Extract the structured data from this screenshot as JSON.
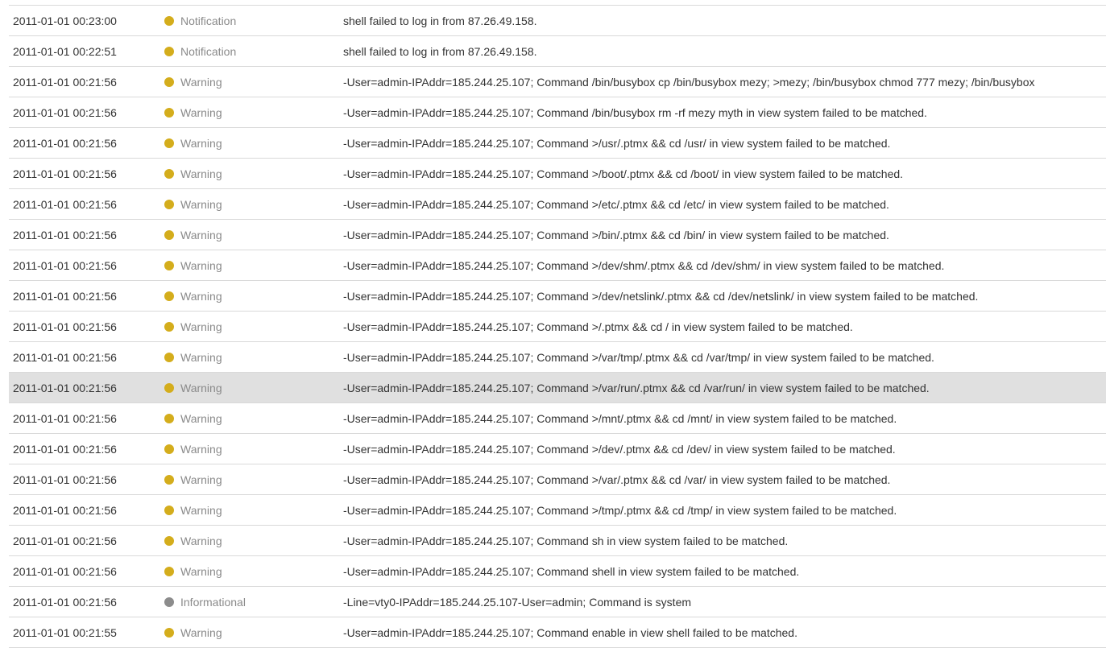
{
  "colors": {
    "warning": "#d4ad1c",
    "notification": "#d4ad1c",
    "informational": "#8c8c8c",
    "selected_row": "#e0e0e0"
  },
  "selected_index": 12,
  "rows": [
    {
      "time": "2011-01-01 00:23:00",
      "level": "Notification",
      "dot": "notification",
      "message": "shell failed to log in from 87.26.49.158."
    },
    {
      "time": "2011-01-01 00:22:51",
      "level": "Notification",
      "dot": "notification",
      "message": "shell failed to log in from 87.26.49.158."
    },
    {
      "time": "2011-01-01 00:21:56",
      "level": "Warning",
      "dot": "warning",
      "message": "-User=admin-IPAddr=185.244.25.107; Command /bin/busybox cp /bin/busybox mezy; >mezy; /bin/busybox chmod 777 mezy; /bin/busybox"
    },
    {
      "time": "2011-01-01 00:21:56",
      "level": "Warning",
      "dot": "warning",
      "message": "-User=admin-IPAddr=185.244.25.107; Command /bin/busybox rm -rf mezy myth in view system failed to be matched."
    },
    {
      "time": "2011-01-01 00:21:56",
      "level": "Warning",
      "dot": "warning",
      "message": "-User=admin-IPAddr=185.244.25.107; Command >/usr/.ptmx && cd /usr/ in view system failed to be matched."
    },
    {
      "time": "2011-01-01 00:21:56",
      "level": "Warning",
      "dot": "warning",
      "message": "-User=admin-IPAddr=185.244.25.107; Command >/boot/.ptmx && cd /boot/ in view system failed to be matched."
    },
    {
      "time": "2011-01-01 00:21:56",
      "level": "Warning",
      "dot": "warning",
      "message": "-User=admin-IPAddr=185.244.25.107; Command >/etc/.ptmx && cd /etc/ in view system failed to be matched."
    },
    {
      "time": "2011-01-01 00:21:56",
      "level": "Warning",
      "dot": "warning",
      "message": "-User=admin-IPAddr=185.244.25.107; Command >/bin/.ptmx && cd /bin/ in view system failed to be matched."
    },
    {
      "time": "2011-01-01 00:21:56",
      "level": "Warning",
      "dot": "warning",
      "message": "-User=admin-IPAddr=185.244.25.107; Command >/dev/shm/.ptmx && cd /dev/shm/ in view system failed to be matched."
    },
    {
      "time": "2011-01-01 00:21:56",
      "level": "Warning",
      "dot": "warning",
      "message": "-User=admin-IPAddr=185.244.25.107; Command >/dev/netslink/.ptmx && cd /dev/netslink/ in view system failed to be matched."
    },
    {
      "time": "2011-01-01 00:21:56",
      "level": "Warning",
      "dot": "warning",
      "message": "-User=admin-IPAddr=185.244.25.107; Command >/.ptmx && cd / in view system failed to be matched."
    },
    {
      "time": "2011-01-01 00:21:56",
      "level": "Warning",
      "dot": "warning",
      "message": "-User=admin-IPAddr=185.244.25.107; Command >/var/tmp/.ptmx && cd /var/tmp/ in view system failed to be matched."
    },
    {
      "time": "2011-01-01 00:21:56",
      "level": "Warning",
      "dot": "warning",
      "message": "-User=admin-IPAddr=185.244.25.107; Command >/var/run/.ptmx && cd /var/run/ in view system failed to be matched."
    },
    {
      "time": "2011-01-01 00:21:56",
      "level": "Warning",
      "dot": "warning",
      "message": "-User=admin-IPAddr=185.244.25.107; Command >/mnt/.ptmx && cd /mnt/ in view system failed to be matched."
    },
    {
      "time": "2011-01-01 00:21:56",
      "level": "Warning",
      "dot": "warning",
      "message": "-User=admin-IPAddr=185.244.25.107; Command >/dev/.ptmx && cd /dev/ in view system failed to be matched."
    },
    {
      "time": "2011-01-01 00:21:56",
      "level": "Warning",
      "dot": "warning",
      "message": "-User=admin-IPAddr=185.244.25.107; Command >/var/.ptmx && cd /var/ in view system failed to be matched."
    },
    {
      "time": "2011-01-01 00:21:56",
      "level": "Warning",
      "dot": "warning",
      "message": "-User=admin-IPAddr=185.244.25.107; Command >/tmp/.ptmx && cd /tmp/ in view system failed to be matched."
    },
    {
      "time": "2011-01-01 00:21:56",
      "level": "Warning",
      "dot": "warning",
      "message": "-User=admin-IPAddr=185.244.25.107; Command sh in view system failed to be matched."
    },
    {
      "time": "2011-01-01 00:21:56",
      "level": "Warning",
      "dot": "warning",
      "message": "-User=admin-IPAddr=185.244.25.107; Command shell in view system failed to be matched."
    },
    {
      "time": "2011-01-01 00:21:56",
      "level": "Informational",
      "dot": "informational",
      "message": "-Line=vty0-IPAddr=185.244.25.107-User=admin; Command is system"
    },
    {
      "time": "2011-01-01 00:21:55",
      "level": "Warning",
      "dot": "warning",
      "message": "-User=admin-IPAddr=185.244.25.107; Command enable in view shell failed to be matched."
    }
  ]
}
